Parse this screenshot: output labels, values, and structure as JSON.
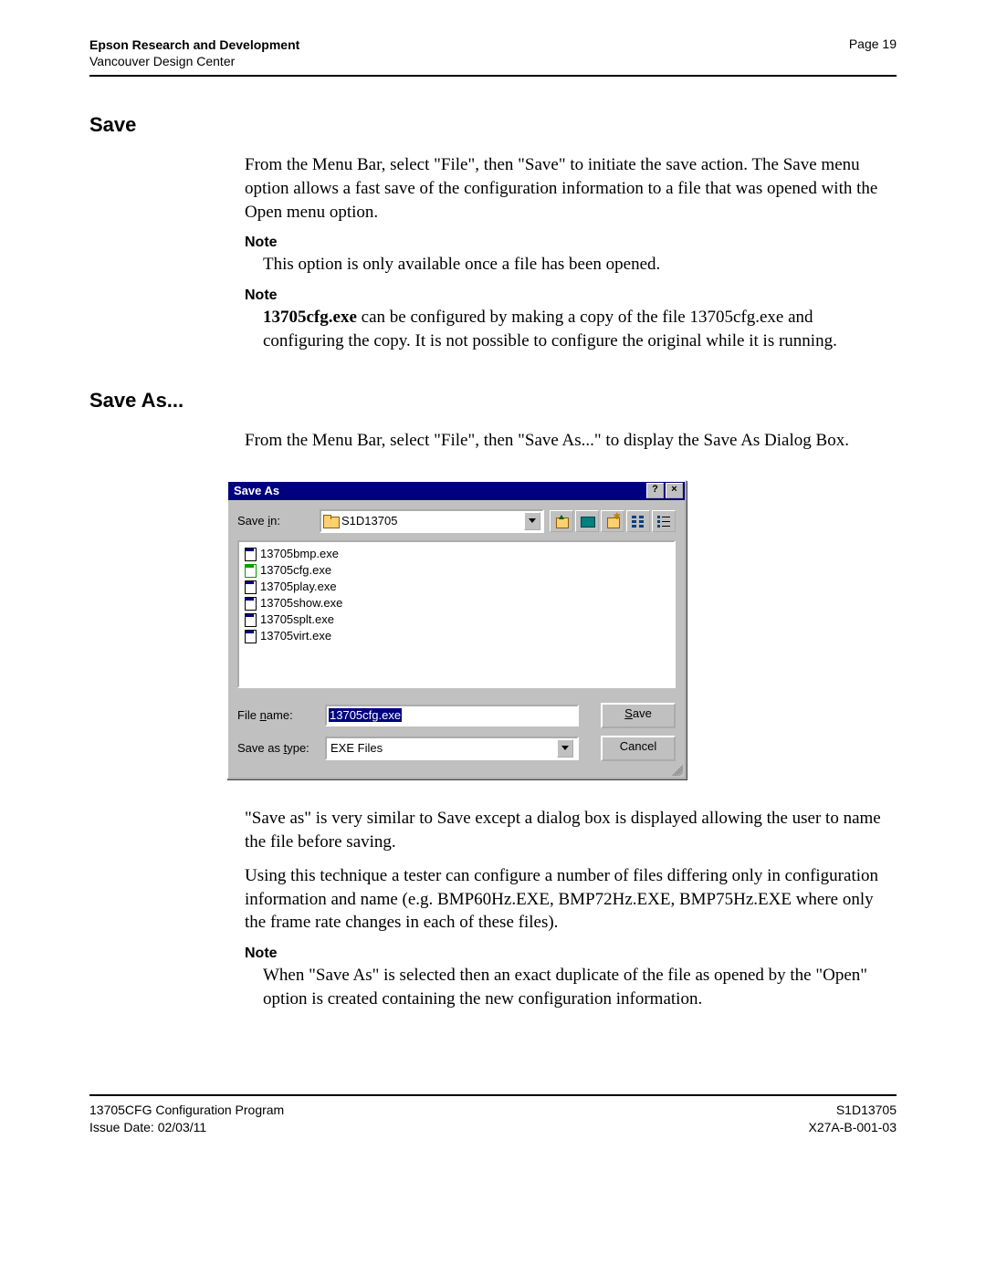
{
  "header": {
    "org": "Epson Research and Development",
    "dept": "Vancouver Design Center",
    "page": "Page 19"
  },
  "section1": {
    "title": "Save",
    "para1": "From the Menu Bar, select \"File\", then \"Save\" to initiate the save action. The Save menu option allows a fast save of the configuration information to a file that was opened with the Open menu option.",
    "note1_label": "Note",
    "note1_text": "This option is only available once a file has been opened.",
    "note2_label": "Note",
    "note2_bold": "13705cfg.exe",
    "note2_rest": " can be configured by making a copy of the file 13705cfg.exe and configuring the copy. It is not possible to configure the original while it is running."
  },
  "section2": {
    "title": "Save As...",
    "para1": "From the Menu Bar, select \"File\", then \"Save As...\" to display the Save As Dialog Box.",
    "para2": "\"Save as\" is very similar to Save except a dialog box is displayed allowing the user to name the file before saving.",
    "para3": "Using this technique a tester can configure a number of files differing only in configuration information and name (e.g. BMP60Hz.EXE, BMP72Hz.EXE, BMP75Hz.EXE where only the frame rate changes in each of these files).",
    "note_label": "Note",
    "note_text": "When \"Save As\" is selected then an exact duplicate of the file as opened by the \"Open\" option is created containing the new configuration information."
  },
  "dialog": {
    "title": "Save As",
    "help_btn": "?",
    "close_btn": "×",
    "savein_label_pre": "Save ",
    "savein_label_u": "i",
    "savein_label_post": "n:",
    "savein_value": "S1D13705",
    "files": [
      "13705bmp.exe",
      "13705cfg.exe",
      "13705play.exe",
      "13705show.exe",
      "13705splt.exe",
      "13705virt.exe"
    ],
    "filename_label_pre": "File ",
    "filename_label_u": "n",
    "filename_label_post": "ame:",
    "filename_value": "13705cfg.exe",
    "type_label_pre": "Save as ",
    "type_label_u": "t",
    "type_label_post": "ype:",
    "type_value": "EXE Files",
    "save_btn_u": "S",
    "save_btn_rest": "ave",
    "cancel_btn": "Cancel"
  },
  "footer": {
    "left1": "13705CFG Configuration Program",
    "left2": "Issue Date: 02/03/11",
    "right1": "S1D13705",
    "right2": "X27A-B-001-03"
  }
}
